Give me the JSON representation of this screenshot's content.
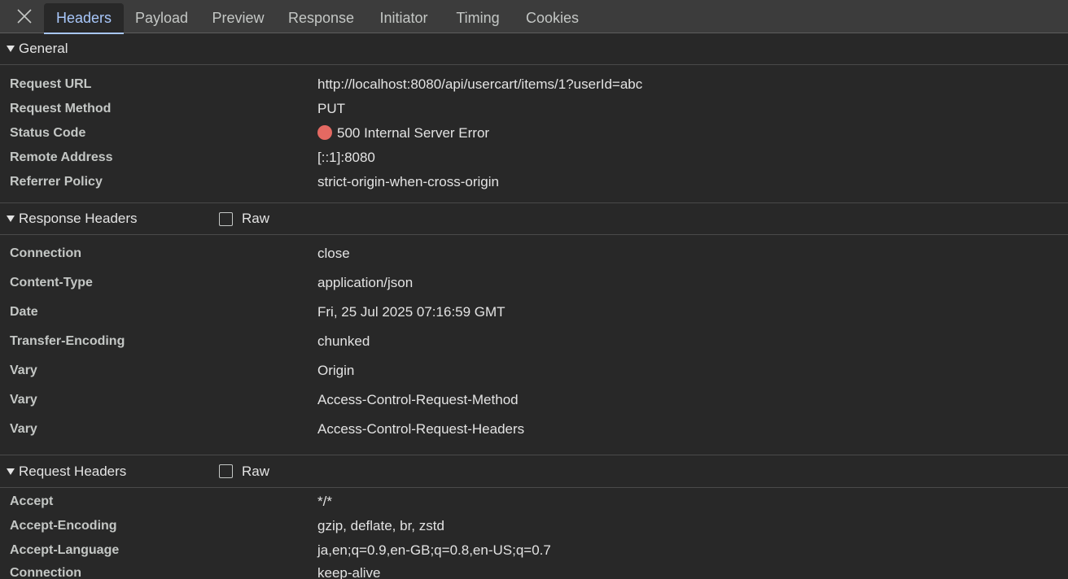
{
  "tabs": [
    "Headers",
    "Payload",
    "Preview",
    "Response",
    "Initiator",
    "Timing",
    "Cookies"
  ],
  "general": {
    "title": "General",
    "rows": [
      {
        "key": "Request URL",
        "value": "http://localhost:8080/api/usercart/items/1?userId=abc"
      },
      {
        "key": "Request Method",
        "value": "PUT"
      },
      {
        "key": "Status Code",
        "value": "500 Internal Server Error"
      },
      {
        "key": "Remote Address",
        "value": "[::1]:8080"
      },
      {
        "key": "Referrer Policy",
        "value": "strict-origin-when-cross-origin"
      }
    ]
  },
  "response_headers": {
    "title": "Response Headers",
    "raw_label": "Raw",
    "rows": [
      {
        "key": "Connection",
        "value": "close"
      },
      {
        "key": "Content-Type",
        "value": "application/json"
      },
      {
        "key": "Date",
        "value": "Fri, 25 Jul 2025 07:16:59 GMT"
      },
      {
        "key": "Transfer-Encoding",
        "value": "chunked"
      },
      {
        "key": "Vary",
        "value": "Origin"
      },
      {
        "key": "Vary",
        "value": "Access-Control-Request-Method"
      },
      {
        "key": "Vary",
        "value": "Access-Control-Request-Headers"
      }
    ]
  },
  "request_headers": {
    "title": "Request Headers",
    "raw_label": "Raw",
    "rows": [
      {
        "key": "Accept",
        "value": "*/*"
      },
      {
        "key": "Accept-Encoding",
        "value": "gzip, deflate, br, zstd"
      },
      {
        "key": "Accept-Language",
        "value": "ja,en;q=0.9,en-GB;q=0.8,en-US;q=0.7"
      },
      {
        "key": "Connection",
        "value": "keep-alive"
      }
    ]
  },
  "colors": {
    "status_error": "#e46962",
    "active_tab": "#a8c7fa"
  },
  "icons": {
    "close": "close-icon",
    "section_toggle": "triangle-down-icon",
    "status": "status-dot-icon"
  }
}
